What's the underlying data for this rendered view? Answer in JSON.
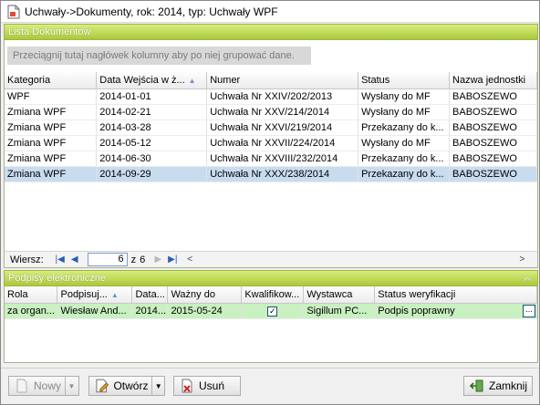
{
  "window": {
    "title": "Uchwały->Dokumenty, rok: 2014, typ: Uchwały WPF"
  },
  "documents_panel": {
    "title": "Lista Dokumentów",
    "group_hint": "Przeciągnij tutaj nagłówek kolumny aby po niej grupować dane.",
    "columns": [
      "Kategoria",
      "Data Wejścia w ż...",
      "Numer",
      "Status",
      "Nazwa jednostki"
    ],
    "rows": [
      [
        "WPF",
        "2014-01-01",
        "Uchwała Nr XXIV/202/2013",
        "Wysłany do MF",
        "BABOSZEWO"
      ],
      [
        "Zmiana WPF",
        "2014-02-21",
        "Uchwała Nr XXV/214/2014",
        "Wysłany do MF",
        "BABOSZEWO"
      ],
      [
        "Zmiana WPF",
        "2014-03-28",
        "Uchwała Nr XXVI/219/2014",
        "Przekazany do k...",
        "BABOSZEWO"
      ],
      [
        "Zmiana WPF",
        "2014-05-12",
        "Uchwała Nr XXVII/224/2014",
        "Wysłany do MF",
        "BABOSZEWO"
      ],
      [
        "Zmiana WPF",
        "2014-06-30",
        "Uchwała Nr XXVIII/232/2014",
        "Przekazany do k...",
        "BABOSZEWO"
      ],
      [
        "Zmiana WPF",
        "2014-09-29",
        "Uchwała Nr XXX/238/2014",
        "Przekazany do k...",
        "BABOSZEWO"
      ]
    ],
    "selected_row": 5,
    "pager": {
      "label": "Wiersz:",
      "current": "6",
      "of": "z",
      "total": "6"
    }
  },
  "signatures_panel": {
    "title": "Podpisy elektroniczne",
    "columns": [
      "Rola",
      "Podpisuj...",
      "Data...",
      "Ważny do",
      "Kwalifikow...",
      "Wystawca",
      "Status weryfikacji"
    ],
    "rows": [
      {
        "rola": "za organ...",
        "podpisujacy": "Wiesław And...",
        "data": "2014...",
        "wazny_do": "2015-05-24",
        "kwalifikowany": true,
        "wystawca": "Sigillum PC...",
        "status": "Podpis poprawny",
        "btn": "..."
      }
    ]
  },
  "toolbar": {
    "new_label": "Nowy",
    "open_label": "Otwórz",
    "delete_label": "Usuń",
    "close_label": "Zamknij"
  },
  "colors": {
    "accent_green": "#a9c93a",
    "selected_row": "#c8dcf0",
    "signature_row": "#c9f0c0"
  }
}
